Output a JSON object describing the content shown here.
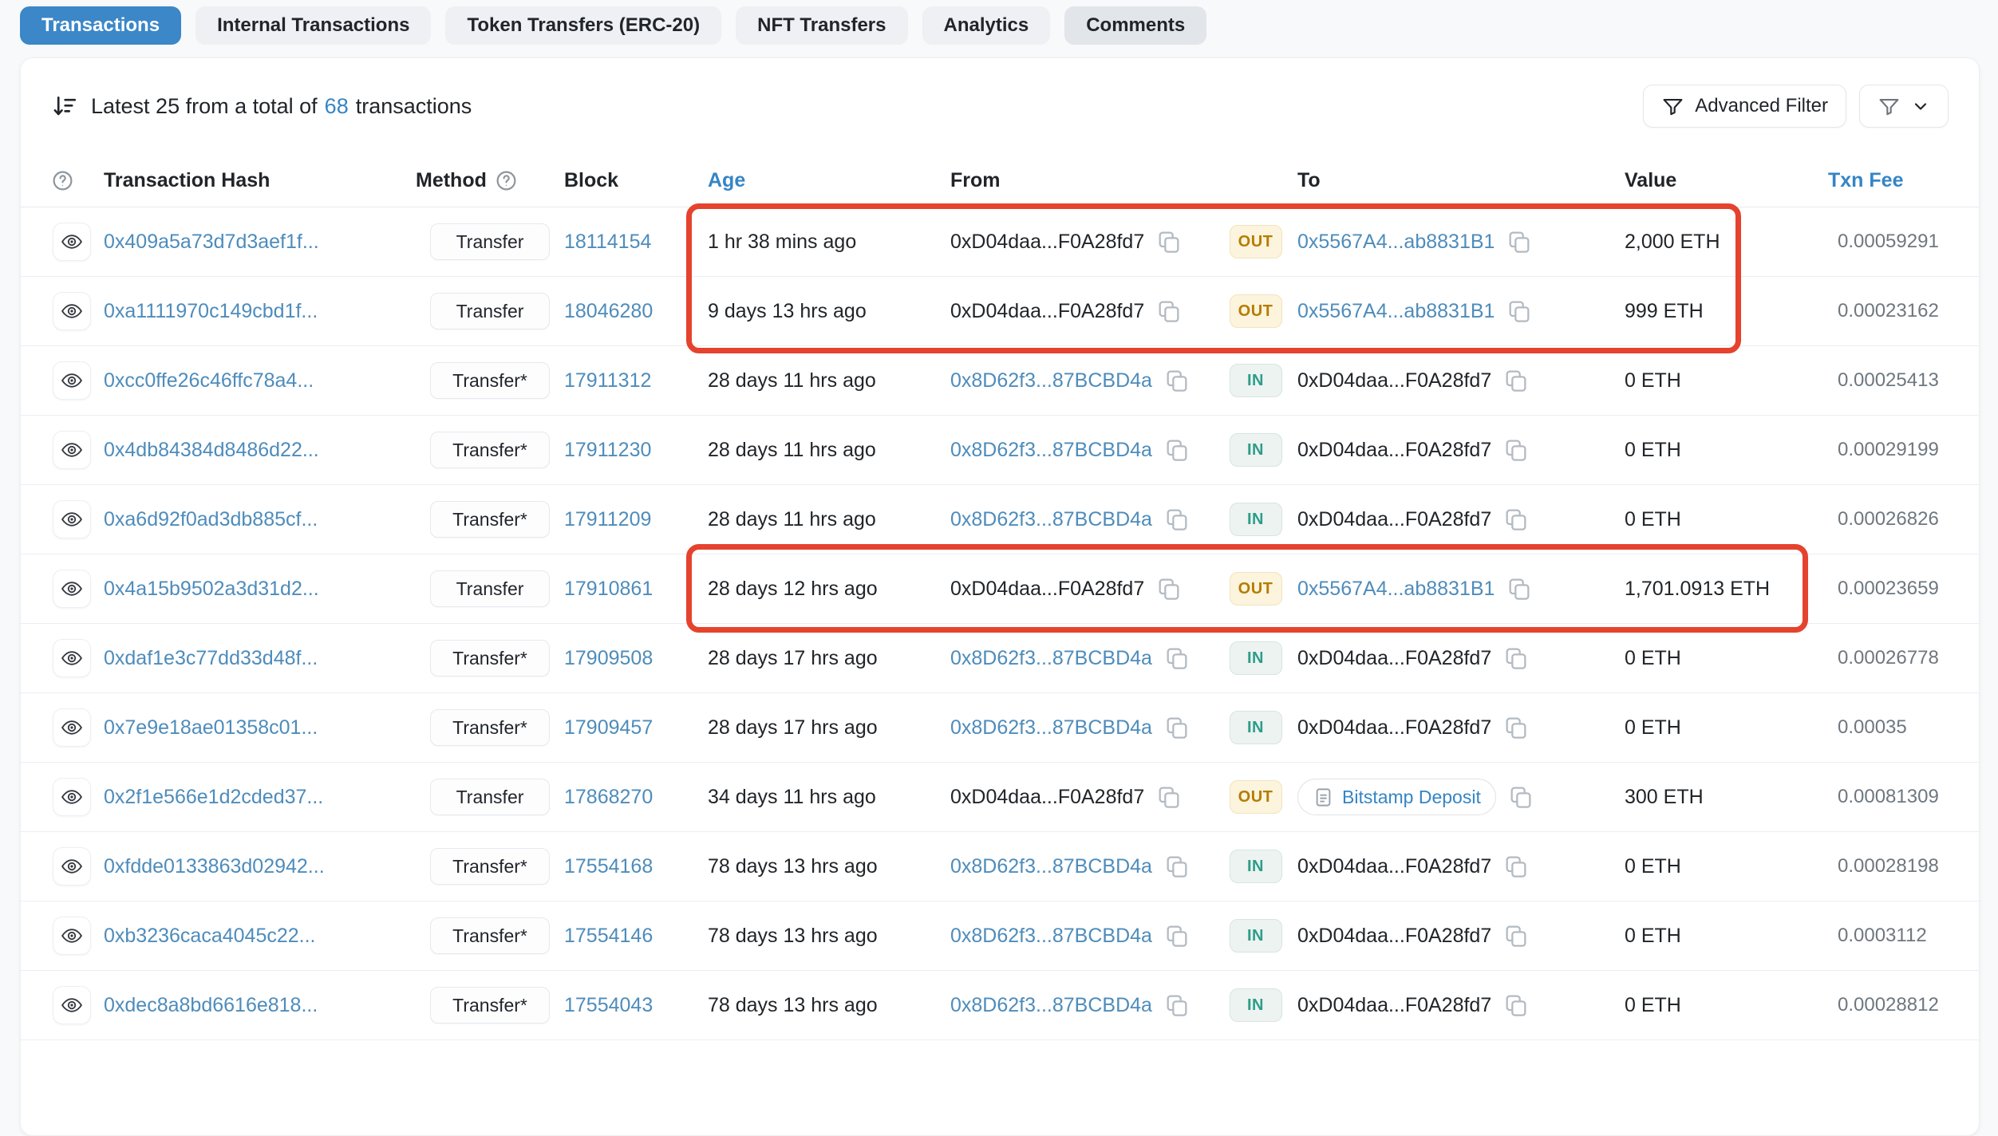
{
  "tabs": [
    {
      "label": "Transactions",
      "active": true
    },
    {
      "label": "Internal Transactions",
      "active": false
    },
    {
      "label": "Token Transfers (ERC-20)",
      "active": false
    },
    {
      "label": "NFT Transfers",
      "active": false
    },
    {
      "label": "Analytics",
      "active": false
    },
    {
      "label": "Comments",
      "active": false
    }
  ],
  "summary": {
    "prefix": "Latest 25 from a total of",
    "count": "68",
    "suffix": "transactions"
  },
  "toolbar": {
    "advanced_filter_label": "Advanced Filter"
  },
  "icons": {
    "summary": "sort-descending-icon",
    "header_help": "question-circle-icon",
    "filter": "funnel-icon",
    "dropdown": "chevron-down-icon",
    "row_view": "eye-icon",
    "address_copy": "copy-icon",
    "name_tag": "document-icon"
  },
  "table": {
    "headers": {
      "hash": "Transaction Hash",
      "method": "Method",
      "block": "Block",
      "age": "Age",
      "from": "From",
      "to": "To",
      "value": "Value",
      "fee": "Txn Fee"
    },
    "rows": [
      {
        "hash": "0x409a5a73d7d3aef1f...",
        "method": "Transfer",
        "block": "18114154",
        "age": "1 hr 38 mins ago",
        "from": {
          "text": "0xD04daa...F0A28fd7",
          "link": false
        },
        "dir": "OUT",
        "to": {
          "text": "0x5567A4...ab8831B1",
          "link": true,
          "pill": false
        },
        "value": "2,000 ETH",
        "fee": "0.00059291"
      },
      {
        "hash": "0xa1111970c149cbd1f...",
        "method": "Transfer",
        "block": "18046280",
        "age": "9 days 13 hrs ago",
        "from": {
          "text": "0xD04daa...F0A28fd7",
          "link": false
        },
        "dir": "OUT",
        "to": {
          "text": "0x5567A4...ab8831B1",
          "link": true,
          "pill": false
        },
        "value": "999 ETH",
        "fee": "0.00023162"
      },
      {
        "hash": "0xcc0ffe26c46ffc78a4...",
        "method": "Transfer*",
        "block": "17911312",
        "age": "28 days 11 hrs ago",
        "from": {
          "text": "0x8D62f3...87BCBD4a",
          "link": true
        },
        "dir": "IN",
        "to": {
          "text": "0xD04daa...F0A28fd7",
          "link": false,
          "pill": false
        },
        "value": "0 ETH",
        "fee": "0.00025413"
      },
      {
        "hash": "0x4db84384d8486d22...",
        "method": "Transfer*",
        "block": "17911230",
        "age": "28 days 11 hrs ago",
        "from": {
          "text": "0x8D62f3...87BCBD4a",
          "link": true
        },
        "dir": "IN",
        "to": {
          "text": "0xD04daa...F0A28fd7",
          "link": false,
          "pill": false
        },
        "value": "0 ETH",
        "fee": "0.00029199"
      },
      {
        "hash": "0xa6d92f0ad3db885cf...",
        "method": "Transfer*",
        "block": "17911209",
        "age": "28 days 11 hrs ago",
        "from": {
          "text": "0x8D62f3...87BCBD4a",
          "link": true
        },
        "dir": "IN",
        "to": {
          "text": "0xD04daa...F0A28fd7",
          "link": false,
          "pill": false
        },
        "value": "0 ETH",
        "fee": "0.00026826"
      },
      {
        "hash": "0x4a15b9502a3d31d2...",
        "method": "Transfer",
        "block": "17910861",
        "age": "28 days 12 hrs ago",
        "from": {
          "text": "0xD04daa...F0A28fd7",
          "link": false
        },
        "dir": "OUT",
        "to": {
          "text": "0x5567A4...ab8831B1",
          "link": true,
          "pill": false
        },
        "value": "1,701.0913 ETH",
        "fee": "0.00023659"
      },
      {
        "hash": "0xdaf1e3c77dd33d48f...",
        "method": "Transfer*",
        "block": "17909508",
        "age": "28 days 17 hrs ago",
        "from": {
          "text": "0x8D62f3...87BCBD4a",
          "link": true
        },
        "dir": "IN",
        "to": {
          "text": "0xD04daa...F0A28fd7",
          "link": false,
          "pill": false
        },
        "value": "0 ETH",
        "fee": "0.00026778"
      },
      {
        "hash": "0x7e9e18ae01358c01...",
        "method": "Transfer*",
        "block": "17909457",
        "age": "28 days 17 hrs ago",
        "from": {
          "text": "0x8D62f3...87BCBD4a",
          "link": true
        },
        "dir": "IN",
        "to": {
          "text": "0xD04daa...F0A28fd7",
          "link": false,
          "pill": false
        },
        "value": "0 ETH",
        "fee": "0.00035"
      },
      {
        "hash": "0x2f1e566e1d2cded37...",
        "method": "Transfer",
        "block": "17868270",
        "age": "34 days 11 hrs ago",
        "from": {
          "text": "0xD04daa...F0A28fd7",
          "link": false
        },
        "dir": "OUT",
        "to": {
          "text": "Bitstamp Deposit",
          "link": true,
          "pill": true
        },
        "value": "300 ETH",
        "fee": "0.00081309"
      },
      {
        "hash": "0xfdde0133863d02942...",
        "method": "Transfer*",
        "block": "17554168",
        "age": "78 days 13 hrs ago",
        "from": {
          "text": "0x8D62f3...87BCBD4a",
          "link": true
        },
        "dir": "IN",
        "to": {
          "text": "0xD04daa...F0A28fd7",
          "link": false,
          "pill": false
        },
        "value": "0 ETH",
        "fee": "0.00028198"
      },
      {
        "hash": "0xb3236caca4045c22...",
        "method": "Transfer*",
        "block": "17554146",
        "age": "78 days 13 hrs ago",
        "from": {
          "text": "0x8D62f3...87BCBD4a",
          "link": true
        },
        "dir": "IN",
        "to": {
          "text": "0xD04daa...F0A28fd7",
          "link": false,
          "pill": false
        },
        "value": "0 ETH",
        "fee": "0.0003112"
      },
      {
        "hash": "0xdec8a8bd6616e818...",
        "method": "Transfer*",
        "block": "17554043",
        "age": "78 days 13 hrs ago",
        "from": {
          "text": "0x8D62f3...87BCBD4a",
          "link": true
        },
        "dir": "IN",
        "to": {
          "text": "0xD04daa...F0A28fd7",
          "link": false,
          "pill": false
        },
        "value": "0 ETH",
        "fee": "0.00028812"
      }
    ]
  },
  "colors": {
    "accent": "#3b87c8",
    "link": "#4e8cbb",
    "header_link": "#3585c5",
    "highlight": "#e5432e",
    "out_bg": "#fcf4dd",
    "out_border": "#f1e3bd",
    "out_text": "#b47d00",
    "in_bg": "#edf3f0",
    "in_border": "#d7e5e0",
    "in_text": "#2d9d8a",
    "fee_text": "#6e777f"
  }
}
